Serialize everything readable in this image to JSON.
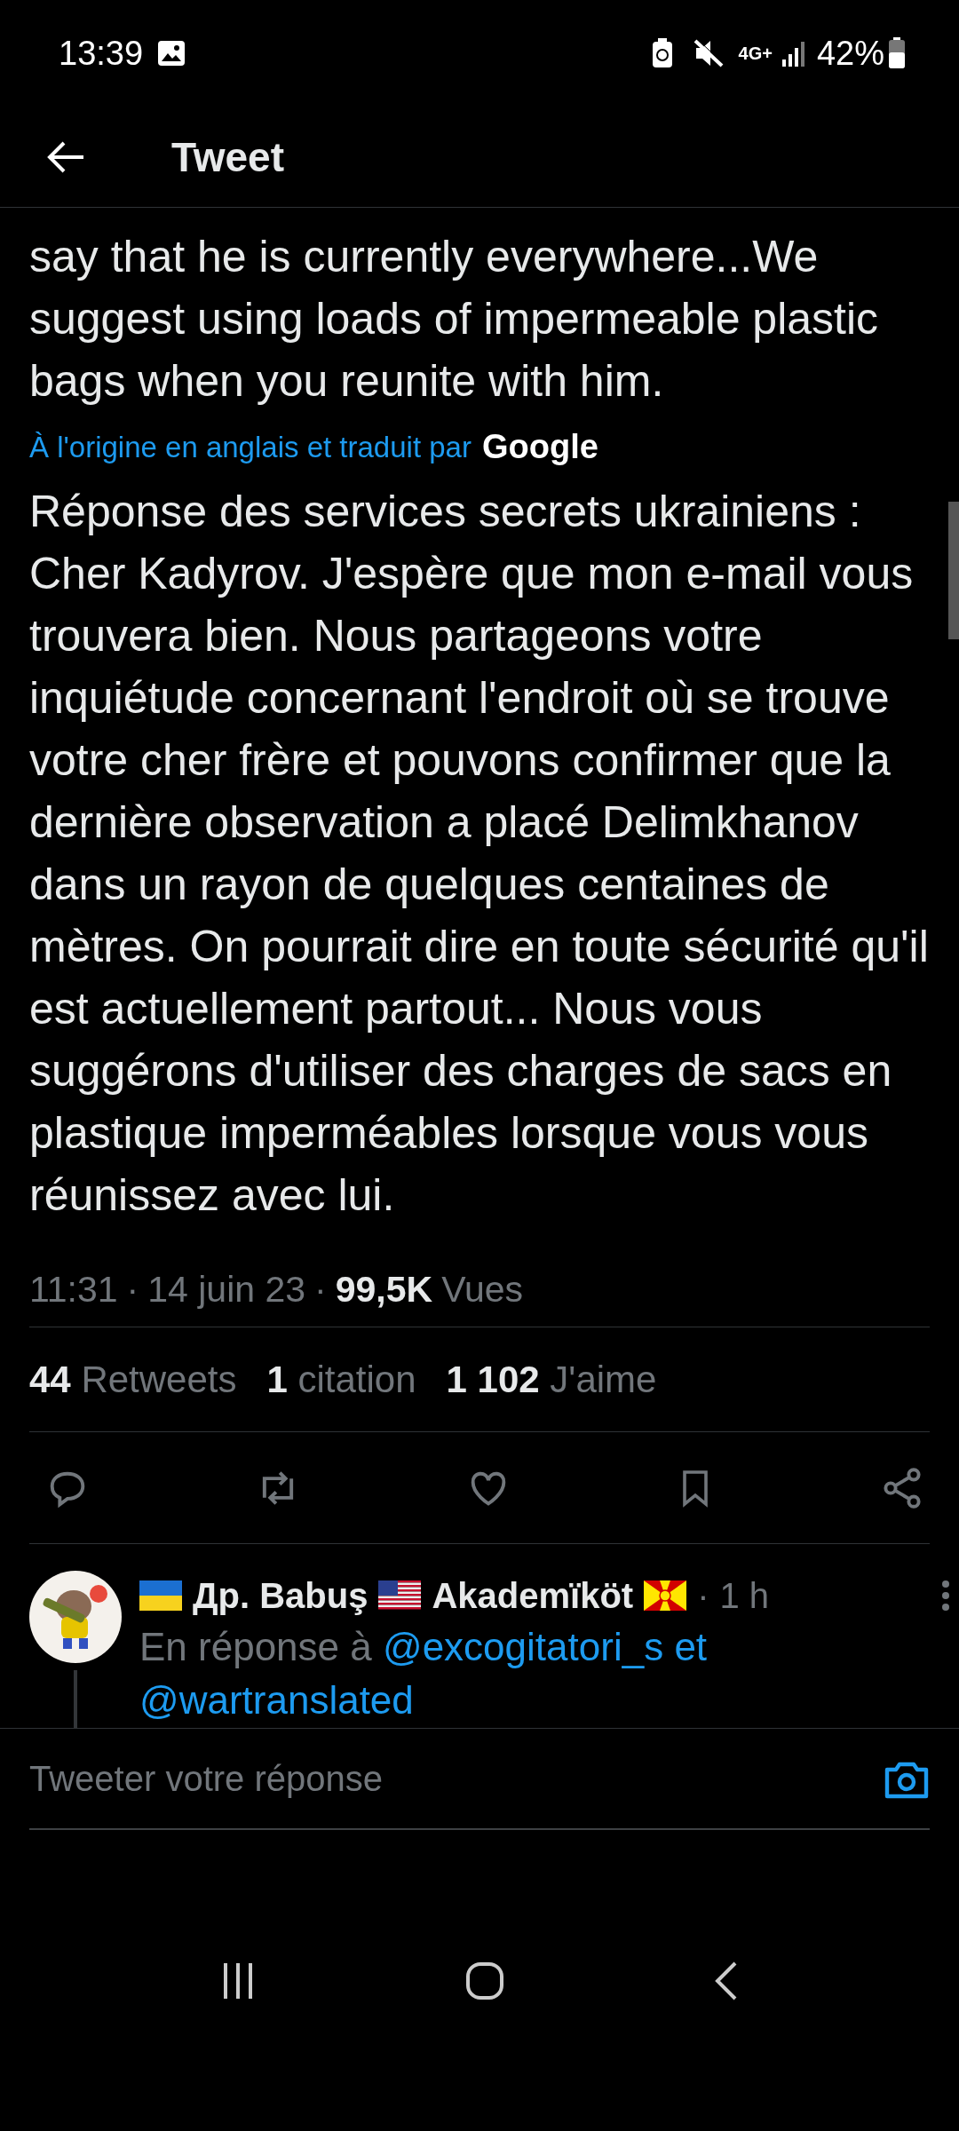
{
  "status_bar": {
    "time": "13:39",
    "network": "4G+",
    "battery": "42%"
  },
  "header": {
    "title": "Tweet"
  },
  "tweet": {
    "original_text": "say that he is currently everywhere...We suggest using loads of impermeable plastic bags when you reunite with him.",
    "translation_note": "À l'origine en anglais et traduit par",
    "translation_brand": "Google",
    "translated_text": "Réponse des services secrets ukrainiens : Cher Kadyrov. J'espère que mon e-mail vous trouvera bien. Nous partageons votre inquiétude concernant l'endroit où se trouve votre cher frère et pouvons confirmer que la dernière observation a placé Delimkhanov dans un rayon de quelques centaines de mètres. On pourrait dire en toute sécurité qu'il est actuellement partout... Nous vous suggérons d'utiliser des charges de sacs en plastique imperméables lorsque vous vous réunissez avec lui.",
    "meta": {
      "separator": "·",
      "time": "11:31",
      "date": "14 juin 23",
      "views_count": "99,5K",
      "views_label": "Vues"
    },
    "stats": [
      {
        "count": "44",
        "label": "Retweets"
      },
      {
        "count": "1",
        "label": "citation"
      },
      {
        "count": "1 102",
        "label": "J'aime"
      }
    ],
    "actions": [
      {
        "kind": "reply"
      },
      {
        "kind": "retweet"
      },
      {
        "kind": "like"
      },
      {
        "kind": "bookmark"
      },
      {
        "kind": "share"
      }
    ]
  },
  "reply": {
    "flags": [
      {
        "kind": "ukraine"
      },
      {
        "kind": "usa"
      },
      {
        "kind": "macedonia"
      }
    ],
    "name_part_1": "Др. Babuş",
    "name_part_2": "Akademïköt",
    "separator": "·",
    "age": "1 h",
    "replying_to": "En réponse à",
    "mentions": [
      "@excogitatori_s",
      "@wartranslated"
    ],
    "conjunction": "et"
  },
  "composer": {
    "placeholder": "Tweeter votre réponse"
  }
}
